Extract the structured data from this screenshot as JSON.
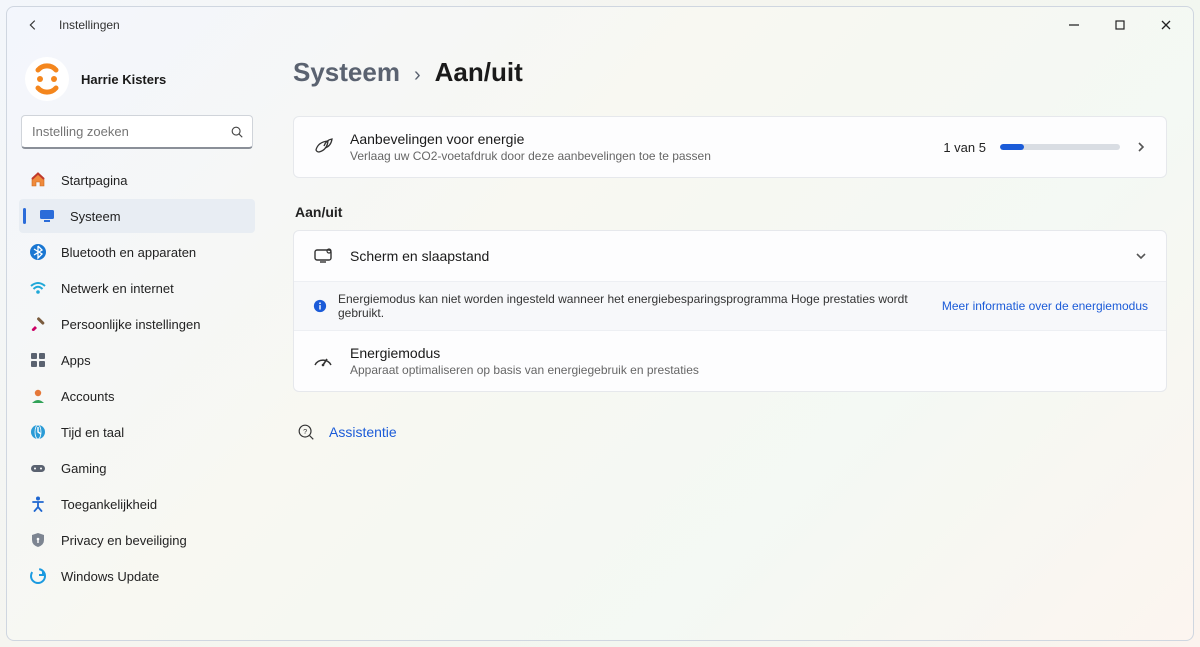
{
  "window": {
    "app_title": "Instellingen"
  },
  "user": {
    "name": "Harrie Kisters"
  },
  "search": {
    "placeholder": "Instelling zoeken",
    "value": ""
  },
  "sidebar": {
    "items": [
      {
        "id": "home",
        "label": "Startpagina",
        "icon": "home-icon"
      },
      {
        "id": "system",
        "label": "Systeem",
        "icon": "monitor-icon",
        "active": true
      },
      {
        "id": "bluetooth",
        "label": "Bluetooth en apparaten",
        "icon": "bluetooth-icon"
      },
      {
        "id": "network",
        "label": "Netwerk en internet",
        "icon": "wifi-icon"
      },
      {
        "id": "personal",
        "label": "Persoonlijke instellingen",
        "icon": "brush-icon"
      },
      {
        "id": "apps",
        "label": "Apps",
        "icon": "apps-icon"
      },
      {
        "id": "accounts",
        "label": "Accounts",
        "icon": "person-icon"
      },
      {
        "id": "time",
        "label": "Tijd en taal",
        "icon": "clock-globe-icon"
      },
      {
        "id": "gaming",
        "label": "Gaming",
        "icon": "gamepad-icon"
      },
      {
        "id": "accessibility",
        "label": "Toegankelijkheid",
        "icon": "accessibility-icon"
      },
      {
        "id": "privacy",
        "label": "Privacy en beveiliging",
        "icon": "shield-icon"
      },
      {
        "id": "update",
        "label": "Windows Update",
        "icon": "update-icon"
      }
    ]
  },
  "breadcrumb": {
    "parent": "Systeem",
    "current": "Aan/uit"
  },
  "recommendations": {
    "title": "Aanbevelingen voor energie",
    "subtitle": "Verlaag uw CO2-voetafdruk door deze aanbevelingen toe te passen",
    "count_label": "1 van 5",
    "progress_pct": 20
  },
  "section_label": "Aan/uit",
  "screen_sleep": {
    "title": "Scherm en slaapstand"
  },
  "info_banner": {
    "text": "Energiemodus kan niet worden ingesteld wanneer het energiebesparingsprogramma Hoge prestaties wordt gebruikt.",
    "link_label": "Meer informatie over de energiemodus"
  },
  "power_mode": {
    "title": "Energiemodus",
    "subtitle": "Apparaat optimaliseren op basis van energiegebruik en prestaties"
  },
  "help": {
    "label": "Assistentie"
  }
}
